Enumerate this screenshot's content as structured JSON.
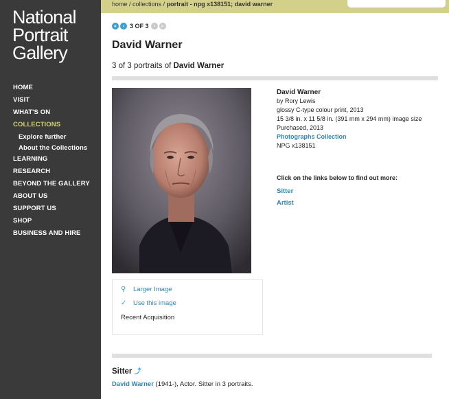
{
  "logo": {
    "line1": "National",
    "line2": "Portrait",
    "line3": "Gallery"
  },
  "nav": [
    {
      "label": "HOME"
    },
    {
      "label": "VISIT"
    },
    {
      "label": "WHAT'S ON"
    },
    {
      "label": "COLLECTIONS"
    },
    {
      "label": "Explore further"
    },
    {
      "label": "About the Collections"
    },
    {
      "label": "LEARNING"
    },
    {
      "label": "RESEARCH"
    },
    {
      "label": "BEYOND THE GALLERY"
    },
    {
      "label": "ABOUT US"
    },
    {
      "label": "SUPPORT US"
    },
    {
      "label": "SHOP"
    },
    {
      "label": "BUSINESS AND HIRE"
    }
  ],
  "breadcrumb": {
    "home": "home",
    "sep": " / ",
    "collections": "collections",
    "current": "portrait - npg x138151; david warner"
  },
  "pager": {
    "text": "3 OF 3"
  },
  "title": "David Warner",
  "subtitle": {
    "prefix": "3 of 3 portraits of ",
    "name": "David Warner"
  },
  "info": {
    "name": "David Warner",
    "by": "by Rory Lewis",
    "medium": "glossy C-type colour print, 2013",
    "size": "15 3/8 in. x 11 5/8 in. (391 mm x 294 mm) image size",
    "purchased": "Purchased, 2013",
    "collection": "Photographs Collection",
    "npg": "NPG x138151"
  },
  "click_info": "Click on the links below to find out more:",
  "links": {
    "sitter": "Sitter",
    "artist": "Artist"
  },
  "image_tools": {
    "larger": "Larger Image",
    "use": "Use this image",
    "recent": "Recent Acquisition"
  },
  "sitter_section": {
    "heading": "Sitter",
    "name": "David Warner",
    "desc": " (1941-), Actor. Sitter in 3 portraits."
  },
  "colors": {
    "sidebar": "#3a3a3a",
    "accent": "#d8d46a",
    "link": "#2f86b5",
    "topbar": "#d3d08a"
  }
}
